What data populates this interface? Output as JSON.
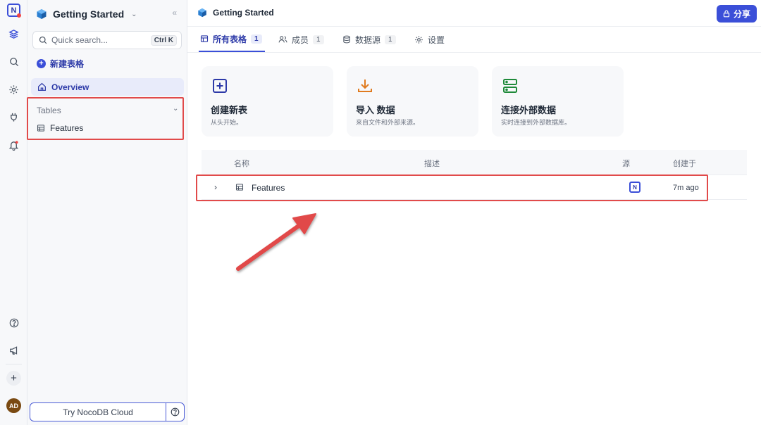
{
  "rail": {
    "logo_letter": "N",
    "avatar_initials": "AD",
    "icons": [
      "base-icon",
      "search-icon",
      "gear-icon",
      "plug-icon",
      "bell-icon",
      "help-icon",
      "megaphone-icon",
      "plus-icon"
    ]
  },
  "sidebar": {
    "base_title": "Getting Started",
    "search_placeholder": "Quick search...",
    "search_shortcut": "Ctrl K",
    "new_table_label": "新建表格",
    "overview_label": "Overview",
    "tables_section_label": "Tables",
    "tables": [
      {
        "label": "Features"
      }
    ],
    "cloud_button_label": "Try NocoDB Cloud"
  },
  "header": {
    "title": "Getting Started",
    "share_label": "分享"
  },
  "tabs": [
    {
      "label": "所有表格",
      "count": "1",
      "active": true
    },
    {
      "label": "成员",
      "count": "1",
      "active": false
    },
    {
      "label": "数据源",
      "count": "1",
      "active": false
    },
    {
      "label": "设置",
      "count": "",
      "active": false
    }
  ],
  "cards": [
    {
      "title": "创建新表",
      "subtitle": "从头开始。",
      "icon": "plus-square-icon",
      "color": "#2d3aa8"
    },
    {
      "title": "导入 数据",
      "subtitle": "来自文件和外部来源。",
      "icon": "download-icon",
      "color": "#e07b1f"
    },
    {
      "title": "连接外部数据",
      "subtitle": "实时连接到外部数据库。",
      "icon": "server-icon",
      "color": "#1f8a3a"
    }
  ],
  "table": {
    "columns": {
      "name": "名称",
      "description": "描述",
      "source": "源",
      "created": "创建于"
    },
    "rows": [
      {
        "name": "Features",
        "description": "",
        "source_logo": "N",
        "created": "7m ago"
      }
    ]
  },
  "colors": {
    "accent": "#3b4fd8",
    "highlight": "#e14a4a"
  }
}
